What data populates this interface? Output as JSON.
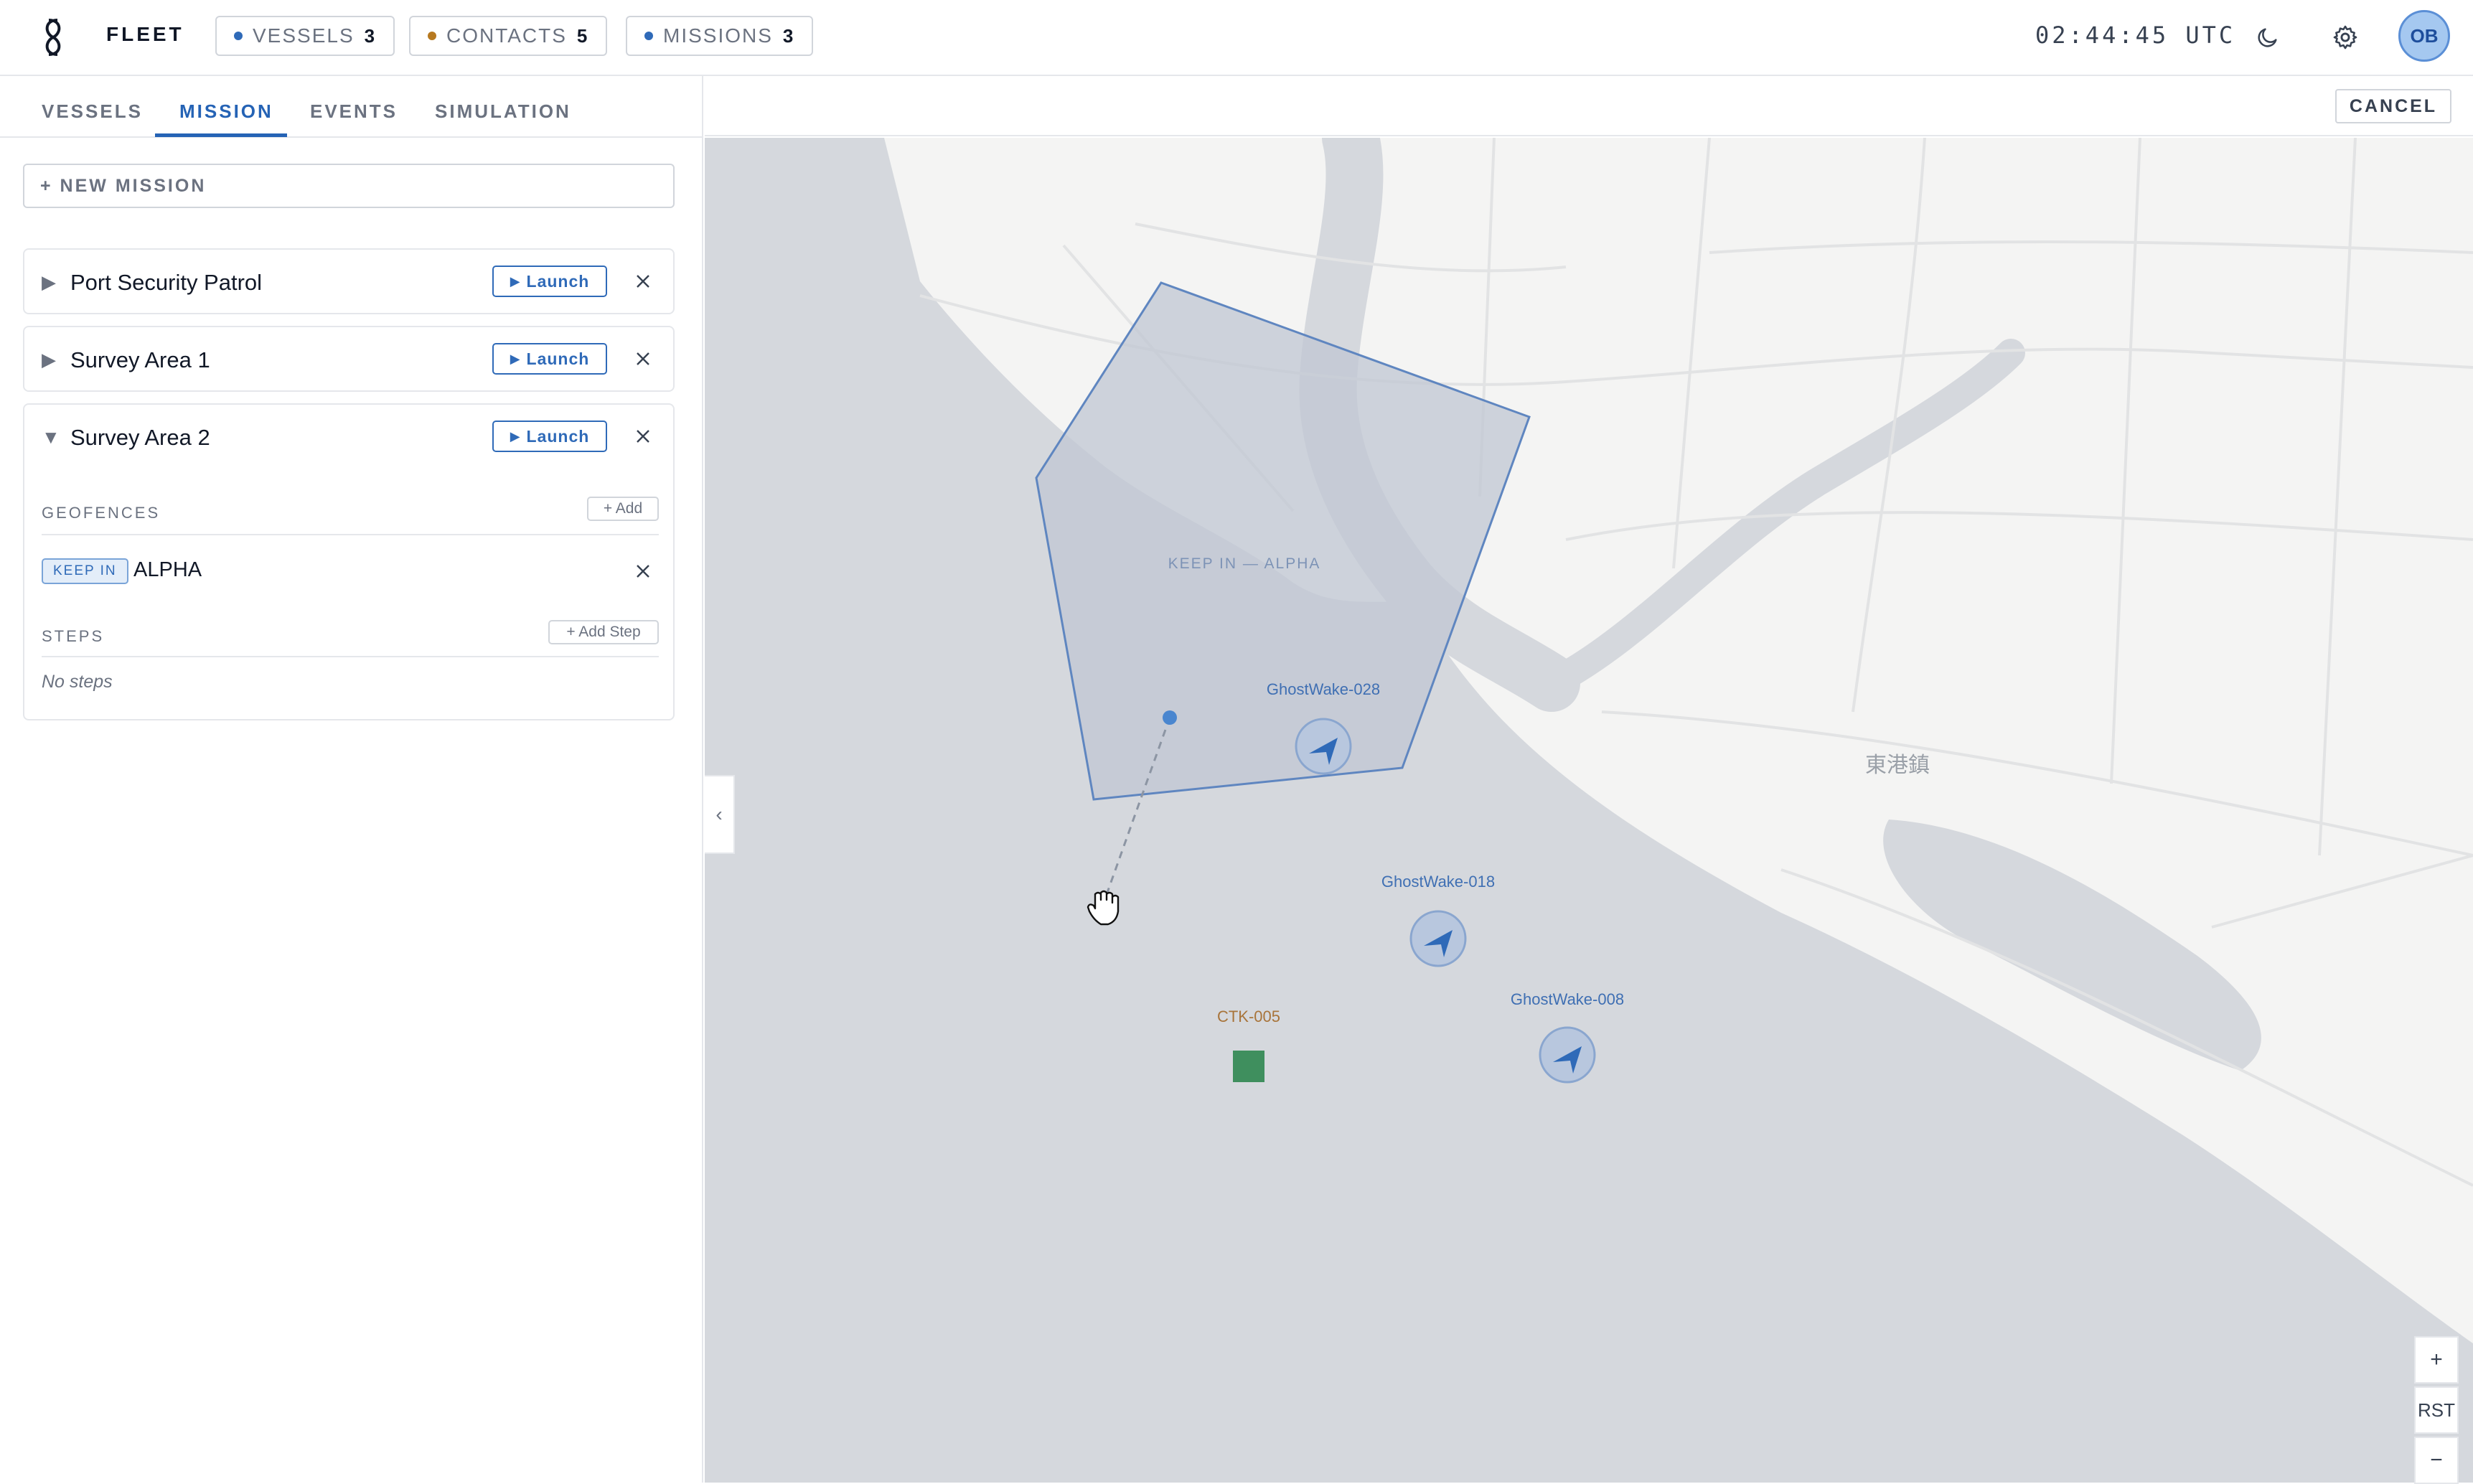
{
  "header": {
    "brand": "FLEET",
    "chips": [
      {
        "label": "VESSELS",
        "count": "3",
        "color": "#2f6ab8"
      },
      {
        "label": "CONTACTS",
        "count": "5",
        "color": "#b7791f"
      },
      {
        "label": "MISSIONS",
        "count": "3",
        "color": "#2f6ab8"
      }
    ],
    "clock": "02:44:45 UTC",
    "avatar_initials": "OB"
  },
  "sidebar": {
    "tabs": [
      "VESSELS",
      "MISSION",
      "EVENTS",
      "SIMULATION"
    ],
    "active_tab": "MISSION",
    "new_mission_label": "+ NEW MISSION",
    "missions": [
      {
        "name": "Port Security Patrol",
        "launch_label": "Launch",
        "expanded": false
      },
      {
        "name": "Survey Area 1",
        "launch_label": "Launch",
        "expanded": false
      },
      {
        "name": "Survey Area 2",
        "launch_label": "Launch",
        "expanded": true
      }
    ],
    "expanded": {
      "geofences_label": "GEOFENCES",
      "add_label": "+ Add",
      "geofence": {
        "type": "KEEP IN",
        "name": "ALPHA"
      },
      "steps_label": "STEPS",
      "add_step_label": "+ Add Step",
      "no_steps": "No steps"
    }
  },
  "map": {
    "cancel_label": "CANCEL",
    "geofence_label": "KEEP IN — ALPHA",
    "place_label": "東港鎮",
    "vessels": [
      "GhostWake-028",
      "GhostWake-018",
      "GhostWake-008"
    ],
    "contact": "CTK-005",
    "zoom_in": "+",
    "zoom_reset": "RST",
    "zoom_out": "−",
    "colors": {
      "accent": "#2f6ab8",
      "water": "#d6d9de",
      "land": "#f4f4f3",
      "contact": "#3f8f5e"
    }
  }
}
